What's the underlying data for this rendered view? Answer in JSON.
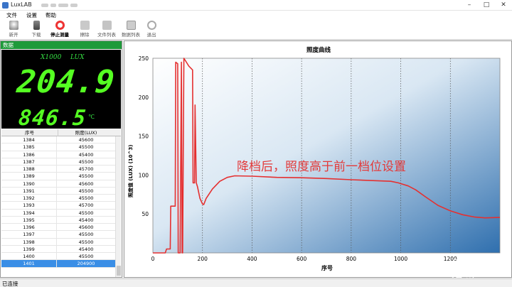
{
  "window": {
    "title": "LuxLAB",
    "controls": [
      "–",
      "□",
      "✕"
    ]
  },
  "menu": {
    "items": [
      "文件",
      "设置",
      "帮助"
    ]
  },
  "toolbar": {
    "buttons": [
      {
        "label": "新开",
        "icon": "bulb-icon"
      },
      {
        "label": "下载",
        "icon": "download-icon"
      },
      {
        "label": "停止测量",
        "icon": "lifebuoy-icon",
        "active": true
      },
      {
        "label": "擦除",
        "icon": "eraser-icon"
      },
      {
        "label": "文件列表",
        "icon": "folder-icon"
      },
      {
        "label": "数据列表",
        "icon": "table-icon"
      },
      {
        "label": "退出",
        "icon": "exit-icon"
      }
    ]
  },
  "data_panel": {
    "header": "数据",
    "display": {
      "multiplier": "X1000",
      "unit": "LUX",
      "main_value": "204.9",
      "secondary_value": "846.5",
      "secondary_unit": "℃"
    },
    "table": {
      "columns": [
        "序号",
        "照度(LUX)"
      ],
      "rows": [
        [
          "1384",
          "45600"
        ],
        [
          "1385",
          "45500"
        ],
        [
          "1386",
          "45400"
        ],
        [
          "1387",
          "45500"
        ],
        [
          "1388",
          "45700"
        ],
        [
          "1389",
          "45500"
        ],
        [
          "1390",
          "45600"
        ],
        [
          "1391",
          "45500"
        ],
        [
          "1392",
          "45500"
        ],
        [
          "1393",
          "45700"
        ],
        [
          "1394",
          "45500"
        ],
        [
          "1395",
          "45400"
        ],
        [
          "1396",
          "45600"
        ],
        [
          "1397",
          "45500"
        ],
        [
          "1398",
          "45500"
        ],
        [
          "1399",
          "45400"
        ],
        [
          "1400",
          "45500"
        ],
        [
          "1401",
          "204900"
        ]
      ],
      "selected_index": 17
    }
  },
  "chart_data": {
    "type": "line",
    "title": "照度曲线",
    "xlabel": "序号",
    "ylabel": "照度值 (LUX) (10^3)",
    "xlim": [
      0,
      1400
    ],
    "ylim": [
      0,
      250
    ],
    "xticks": [
      0,
      200,
      400,
      600,
      800,
      1000,
      1200
    ],
    "yticks": [
      50,
      100,
      150,
      200,
      250
    ],
    "grid": "vertical-dotted",
    "series_color": "#e53030",
    "annotation": "降档后，照度高于前一档位设置",
    "points": [
      [
        0,
        0
      ],
      [
        50,
        0
      ],
      [
        55,
        5
      ],
      [
        70,
        5
      ],
      [
        72,
        60
      ],
      [
        90,
        60
      ],
      [
        92,
        245
      ],
      [
        100,
        243
      ],
      [
        102,
        0
      ],
      [
        110,
        0
      ],
      [
        115,
        245
      ],
      [
        118,
        0
      ],
      [
        120,
        0
      ],
      [
        125,
        250
      ],
      [
        135,
        245
      ],
      [
        145,
        240
      ],
      [
        160,
        235
      ],
      [
        162,
        90
      ],
      [
        168,
        90
      ],
      [
        170,
        190
      ],
      [
        175,
        90
      ],
      [
        180,
        85
      ],
      [
        190,
        70
      ],
      [
        200,
        63
      ],
      [
        205,
        62
      ],
      [
        215,
        70
      ],
      [
        240,
        82
      ],
      [
        270,
        92
      ],
      [
        300,
        97
      ],
      [
        330,
        99
      ],
      [
        400,
        98.5
      ],
      [
        500,
        97
      ],
      [
        600,
        96.5
      ],
      [
        700,
        95.5
      ],
      [
        800,
        94
      ],
      [
        960,
        92
      ],
      [
        990,
        90
      ],
      [
        1000,
        89
      ],
      [
        1030,
        86
      ],
      [
        1060,
        81
      ],
      [
        1100,
        72
      ],
      [
        1150,
        61
      ],
      [
        1200,
        54
      ],
      [
        1250,
        49
      ],
      [
        1300,
        46
      ],
      [
        1340,
        45
      ],
      [
        1400,
        45.5
      ]
    ]
  },
  "status": {
    "text": "已连接"
  },
  "watermark": "值 什么值得买"
}
